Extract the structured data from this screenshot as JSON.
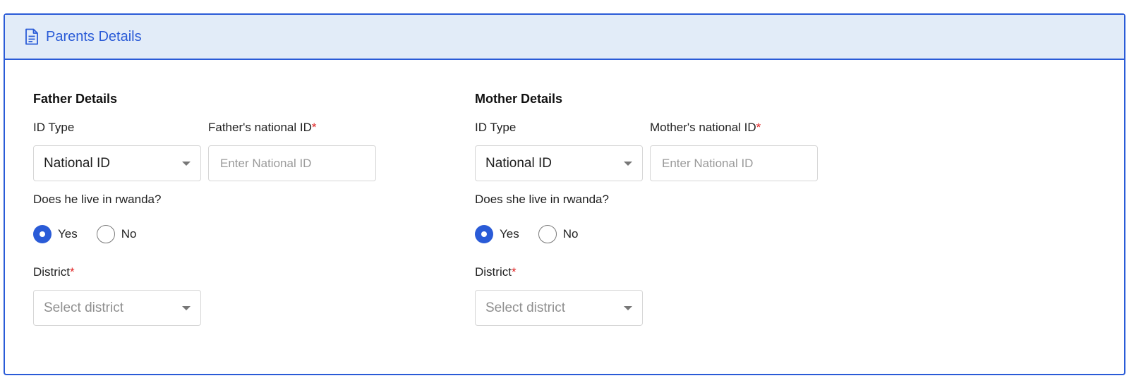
{
  "card": {
    "title": "Parents Details",
    "header_icon": "document-icon"
  },
  "colors": {
    "accent": "#2a5bd7",
    "header_bg": "#e2ecf8",
    "required": "#e02424"
  },
  "father": {
    "title": "Father Details",
    "id_type_label": "ID Type",
    "id_type_value": "National ID",
    "national_id_label": "Father's national ID",
    "national_id_required": "*",
    "national_id_placeholder": "Enter National ID",
    "national_id_value": "",
    "residence_question": "Does he live in rwanda?",
    "options": {
      "yes": "Yes",
      "no": "No"
    },
    "selected_option": "Yes",
    "district_label": "District",
    "district_required": "*",
    "district_placeholder": "Select district"
  },
  "mother": {
    "title": "Mother Details",
    "id_type_label": "ID Type",
    "id_type_value": "National ID",
    "national_id_label": "Mother's national ID",
    "national_id_required": "*",
    "national_id_placeholder": "Enter National ID",
    "national_id_value": "",
    "residence_question": "Does she live in rwanda?",
    "options": {
      "yes": "Yes",
      "no": "No"
    },
    "selected_option": "Yes",
    "district_label": "District",
    "district_required": "*",
    "district_placeholder": "Select district"
  }
}
